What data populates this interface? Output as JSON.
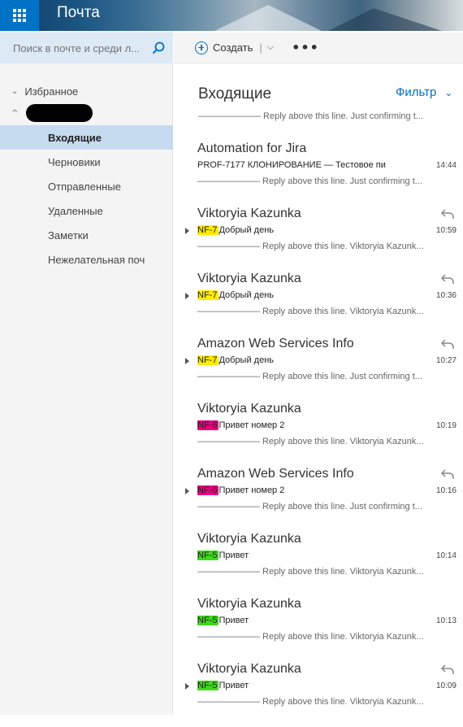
{
  "app": {
    "title": "Почта"
  },
  "search": {
    "placeholder": "Поиск в почте и среди л..."
  },
  "nav": {
    "favorites_label": "Избранное",
    "folders": [
      "Входящие",
      "Черновики",
      "Отправленные",
      "Удаленные",
      "Заметки",
      "Нежелательная поч"
    ]
  },
  "toolbar": {
    "create_label": "Создать",
    "more_label": "•••"
  },
  "list": {
    "header": "Входящие",
    "filter_label": "Фильтр",
    "first_preview": "——————— Reply above this line.  Just confirming t...",
    "messages": [
      {
        "sender": "Automation for Jira",
        "tag": "",
        "subject": "PROF-7177 КЛОНИРОВАНИЕ — Тестовое пи",
        "time": "14:44",
        "preview": "——————— Reply above this line.  Just confirming t...",
        "replied": false,
        "expand": false,
        "tag_color": ""
      },
      {
        "sender": "Viktoryia Kazunka",
        "tag": "NF-7",
        "subject": "Добрый день",
        "time": "10:59",
        "preview": "——————— Reply above this line.  Viktoryia Kazunk...",
        "replied": true,
        "expand": true,
        "tag_color": "yellow"
      },
      {
        "sender": "Viktoryia Kazunka",
        "tag": "NF-7",
        "subject": "Добрый день",
        "time": "10:36",
        "preview": "——————— Reply above this line.  Viktoryia Kazunk...",
        "replied": true,
        "expand": true,
        "tag_color": "yellow"
      },
      {
        "sender": "Amazon Web Services Info",
        "tag": "NF-7",
        "subject": "Добрый день",
        "time": "10:27",
        "preview": "——————— Reply above this line.  Just confirming t...",
        "replied": true,
        "expand": true,
        "tag_color": "yellow"
      },
      {
        "sender": "Viktoryia Kazunka",
        "tag": "NF-6",
        "subject": "Привет номер 2",
        "time": "10:19",
        "preview": "——————— Reply above this line.  Viktoryia Kazunk...",
        "replied": false,
        "expand": false,
        "tag_color": "magenta"
      },
      {
        "sender": "Amazon Web Services Info",
        "tag": "NF-6",
        "subject": "Привет номер 2",
        "time": "10:16",
        "preview": "——————— Reply above this line.  Just confirming t...",
        "replied": true,
        "expand": true,
        "tag_color": "magenta"
      },
      {
        "sender": "Viktoryia Kazunka",
        "tag": "NF-5",
        "subject": "Привет",
        "time": "10:14",
        "preview": "——————— Reply above this line.  Viktoryia Kazunk...",
        "replied": false,
        "expand": false,
        "tag_color": "green"
      },
      {
        "sender": "Viktoryia Kazunka",
        "tag": "NF-5",
        "subject": "Привет",
        "time": "10:13",
        "preview": "——————— Reply above this line.  Viktoryia Kazunk...",
        "replied": false,
        "expand": false,
        "tag_color": "green"
      },
      {
        "sender": "Viktoryia Kazunka",
        "tag": "NF-5",
        "subject": "Привет",
        "time": "10:09",
        "preview": "——————— Reply above this line.  Viktoryia Kazunk...",
        "replied": true,
        "expand": true,
        "tag_color": "green"
      }
    ]
  },
  "colors": {
    "accent": "#0072c6",
    "selected_folder": "#c6daf0",
    "tag_yellow": "#ffeb00",
    "tag_magenta": "#e6007e",
    "tag_green": "#3dd81a"
  }
}
